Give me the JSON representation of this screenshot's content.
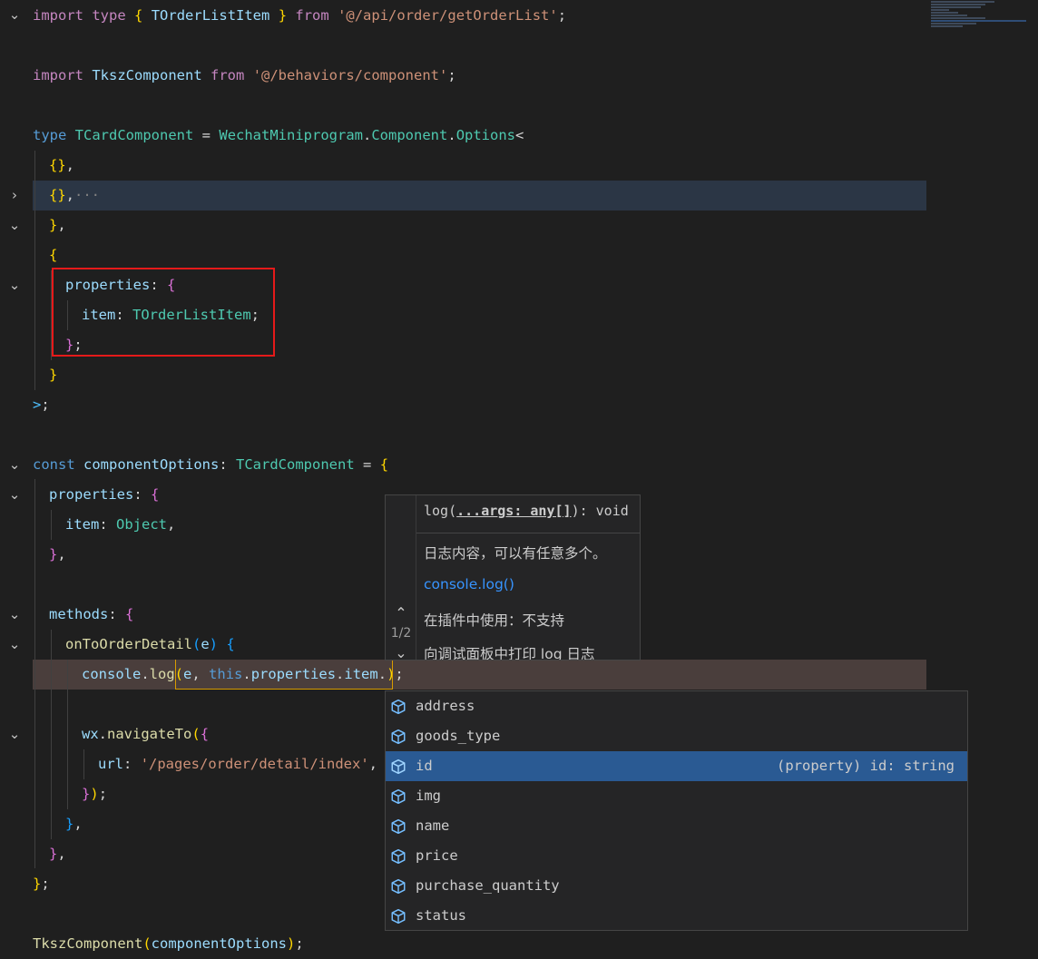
{
  "code": {
    "line1": {
      "t1": "import",
      "t2": "type",
      "t3": "{",
      "t4": "TOrderListItem",
      "t5": "}",
      "t6": "from",
      "t7": "'@/api/order/getOrderList'",
      "t8": ";"
    },
    "line2": {
      "t1": "import",
      "t2": "TkszComponent",
      "t3": "from",
      "t4": "'@/behaviors/component'",
      "t5": ";"
    },
    "line3": {
      "t1": "type",
      "t2": "TCardComponent",
      "t3": "=",
      "t4": "WechatMiniprogram",
      "t5": ".",
      "t6": "Component",
      "t7": ".",
      "t8": "Options",
      "t9": "<"
    },
    "line4": {
      "t1": "{}",
      "t2": ","
    },
    "line5": {
      "t1": "{}",
      "t2": ",",
      "t3": "···"
    },
    "line6": {
      "t1": "}",
      "t2": ","
    },
    "line7": {
      "t1": "{"
    },
    "line8": {
      "t1": "properties",
      "t2": ":",
      "t3": "{"
    },
    "line9": {
      "t1": "item",
      "t2": ":",
      "t3": "TOrderListItem",
      "t4": ";"
    },
    "line10": {
      "t1": "}",
      "t2": ";"
    },
    "line11": {
      "t1": "}"
    },
    "line12": {
      "t1": ">",
      "t2": ";"
    },
    "line13": {
      "t1": "const",
      "t2": "componentOptions",
      "t3": ":",
      "t4": "TCardComponent",
      "t5": "=",
      "t6": "{"
    },
    "line14": {
      "t1": "properties",
      "t2": ":",
      "t3": "{"
    },
    "line15": {
      "t1": "item",
      "t2": ":",
      "t3": "Object",
      "t4": ","
    },
    "line16": {
      "t1": "}",
      "t2": ","
    },
    "line17": {
      "t1": "methods",
      "t2": ":",
      "t3": "{"
    },
    "line18": {
      "t1": "onToOrderDetail",
      "t2": "(",
      "t3": "e",
      "t4": ")",
      "t5": "{"
    },
    "line19": {
      "t1": "console",
      "t2": ".",
      "t3": "log",
      "t4": "(",
      "t5": "e",
      "t6": ",",
      "t7": "this",
      "t8": ".",
      "t9": "properties",
      "t10": ".",
      "t11": "item",
      "t12": ".",
      "t13": ")",
      "t14": ";"
    },
    "line20": {
      "t1": "wx",
      "t2": ".",
      "t3": "navigateTo",
      "t4": "(",
      "t5": "{"
    },
    "line21": {
      "t1": "url",
      "t2": ":",
      "t3": "'/pages/order/detail/index'",
      "t4": ","
    },
    "line22": {
      "t1": "}",
      "t2": ")",
      "t3": ";"
    },
    "line23": {
      "t1": "}",
      "t2": ","
    },
    "line24": {
      "t1": "}",
      "t2": ","
    },
    "line25": {
      "t1": "}",
      "t2": ";"
    },
    "line26": {
      "t1": "TkszComponent",
      "t2": "(",
      "t3": "componentOptions",
      "t4": ")",
      "t5": ";"
    }
  },
  "hover": {
    "signature_prefix": "log(",
    "signature_param": "...args: any[]",
    "signature_suffix": "): void",
    "pager": "1/2",
    "doc1": "日志内容，可以有任意多个。",
    "link": "console.log()",
    "doc2": "在插件中使用：不支持",
    "doc3": "向调试面板中打印 log 日志"
  },
  "suggest": {
    "items": [
      {
        "label": "address"
      },
      {
        "label": "goods_type"
      },
      {
        "label": "id",
        "detail": "(property) id: string",
        "selected": true
      },
      {
        "label": "img"
      },
      {
        "label": "name"
      },
      {
        "label": "price"
      },
      {
        "label": "purchase_quantity"
      },
      {
        "label": "status"
      }
    ],
    "icon": "property-cube-icon"
  },
  "icons": {
    "fold_open": "chevron-down-icon",
    "fold_closed": "chevron-right-icon"
  }
}
